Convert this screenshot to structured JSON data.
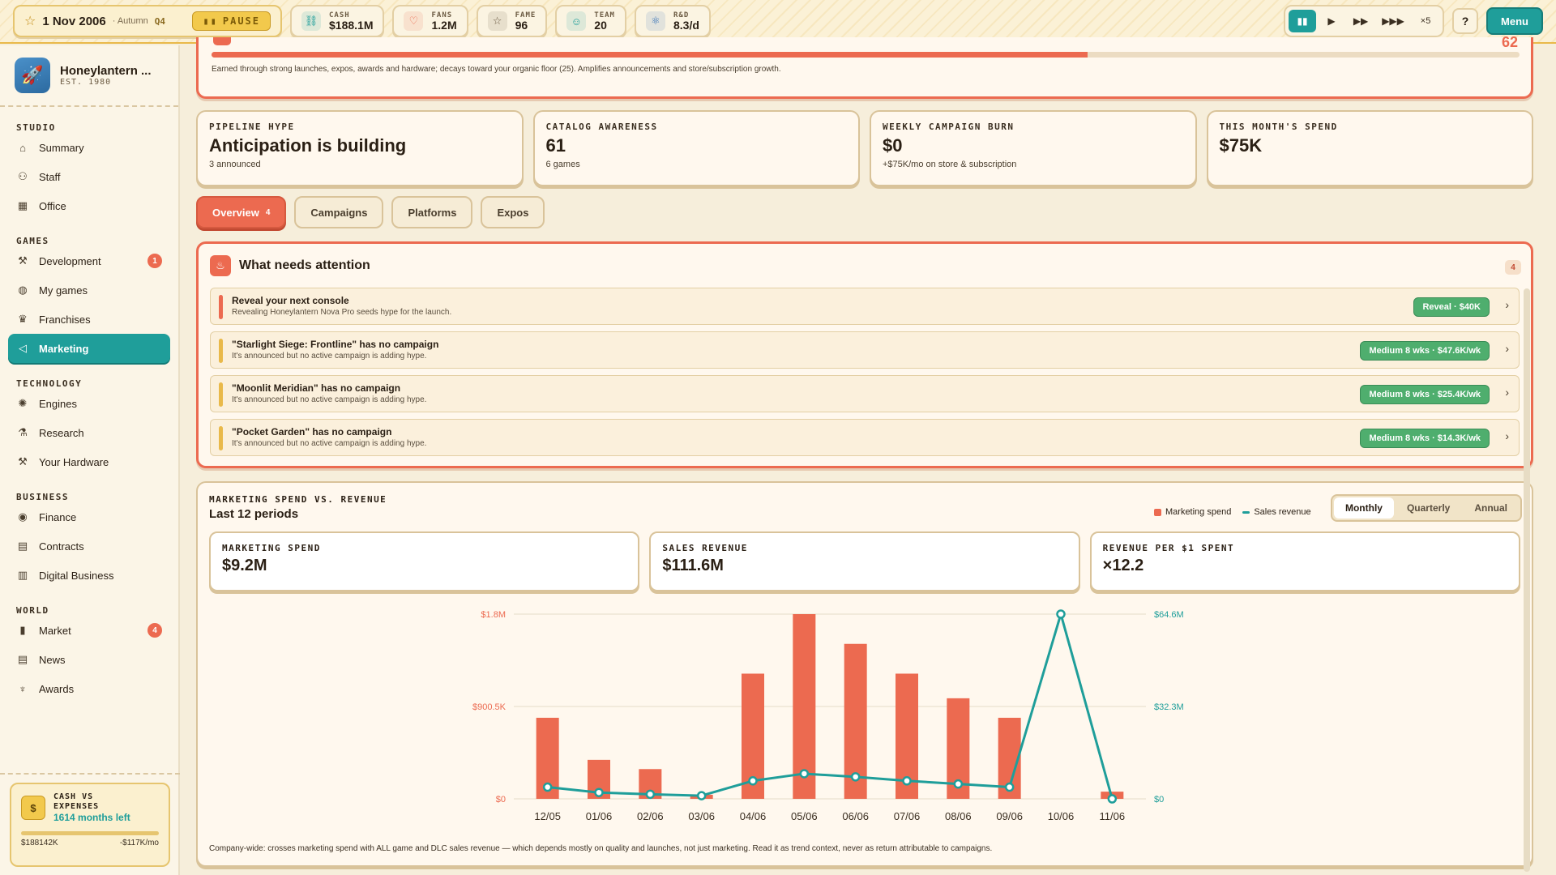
{
  "topbar": {
    "date": "1 Nov 2006",
    "season": "· Autumn",
    "quarter": "Q4",
    "pause_label": "PAUSE",
    "stats": [
      {
        "label": "CASH",
        "value": "$188.1M",
        "icon": "link-icon",
        "color": "#1f9e9a"
      },
      {
        "label": "FANS",
        "value": "1.2M",
        "icon": "heart-icon",
        "color": "#ec6a50"
      },
      {
        "label": "FAME",
        "value": "96",
        "icon": "star-icon",
        "color": "#6b5a42"
      },
      {
        "label": "TEAM",
        "value": "20",
        "icon": "team-icon",
        "color": "#1f9e9a"
      },
      {
        "label": "R&D",
        "value": "8.3/d",
        "icon": "atom-icon",
        "color": "#3a74b8"
      }
    ],
    "speed_multiplier": "×5",
    "help_label": "?",
    "menu_label": "Menu"
  },
  "sidebar": {
    "studio_name": "Honeylantern ...",
    "studio_est": "EST. 1980",
    "sections": [
      {
        "title": "STUDIO",
        "items": [
          {
            "label": "Summary",
            "icon": "home-icon",
            "glyph": "⌂"
          },
          {
            "label": "Staff",
            "icon": "staff-icon",
            "glyph": "⚇"
          },
          {
            "label": "Office",
            "icon": "office-icon",
            "glyph": "▦"
          }
        ]
      },
      {
        "title": "GAMES",
        "items": [
          {
            "label": "Development",
            "icon": "hammer-icon",
            "glyph": "⚒",
            "badge": "1"
          },
          {
            "label": "My games",
            "icon": "gamepad-icon",
            "glyph": "◍"
          },
          {
            "label": "Franchises",
            "icon": "crown-icon",
            "glyph": "♛"
          },
          {
            "label": "Marketing",
            "icon": "megaphone-icon",
            "glyph": "◁",
            "active": true
          }
        ]
      },
      {
        "title": "TECHNOLOGY",
        "items": [
          {
            "label": "Engines",
            "icon": "gear-icon",
            "glyph": "✺"
          },
          {
            "label": "Research",
            "icon": "flask-icon",
            "glyph": "⚗"
          },
          {
            "label": "Your Hardware",
            "icon": "hardware-icon",
            "glyph": "⚒"
          }
        ]
      },
      {
        "title": "BUSINESS",
        "items": [
          {
            "label": "Finance",
            "icon": "coin-icon",
            "glyph": "◉"
          },
          {
            "label": "Contracts",
            "icon": "contract-icon",
            "glyph": "▤"
          },
          {
            "label": "Digital Business",
            "icon": "store-icon",
            "glyph": "▥"
          }
        ]
      },
      {
        "title": "WORLD",
        "items": [
          {
            "label": "Market",
            "icon": "bar-chart-icon",
            "glyph": "▮",
            "badge": "4"
          },
          {
            "label": "News",
            "icon": "newspaper-icon",
            "glyph": "▤"
          },
          {
            "label": "Awards",
            "icon": "trophy-icon",
            "glyph": "♆"
          }
        ]
      }
    ],
    "cash_card": {
      "label": "CASH VS EXPENSES",
      "months_left": "1614 months left",
      "cash": "$188142K",
      "burn": "-$117K/mo",
      "coin": "$"
    }
  },
  "hype": {
    "progress": 0.67,
    "value": "62",
    "description": "Earned through strong launches, expos, awards and hardware; decays toward your organic floor (25). Amplifies announcements and store/subscription growth."
  },
  "cards": [
    {
      "label": "PIPELINE HYPE",
      "value": "Anticipation is building",
      "sub": "3 announced"
    },
    {
      "label": "CATALOG AWARENESS",
      "value": "61",
      "sub": "6 games"
    },
    {
      "label": "WEEKLY CAMPAIGN BURN",
      "value": "$0",
      "sub": "+$75K/mo on store & subscription"
    },
    {
      "label": "THIS MONTH'S SPEND",
      "value": "$75K",
      "sub": ""
    }
  ],
  "tabs": [
    {
      "label": "Overview",
      "count": "4",
      "active": true
    },
    {
      "label": "Campaigns"
    },
    {
      "label": "Platforms"
    },
    {
      "label": "Expos"
    }
  ],
  "attention": {
    "title": "What needs attention",
    "count": "4",
    "items": [
      {
        "title": "Reveal your next console",
        "desc": "Revealing Honeylantern Nova Pro seeds hype for the launch.",
        "action": "Reveal · $40K",
        "stripe": "#ec6a50"
      },
      {
        "title": "\"Starlight Siege: Frontline\" has no campaign",
        "desc": "It's announced but no active campaign is adding hype.",
        "action": "Medium 8 wks · $47.6K/wk",
        "stripe": "#e9b94a"
      },
      {
        "title": "\"Moonlit Meridian\" has no campaign",
        "desc": "It's announced but no active campaign is adding hype.",
        "action": "Medium 8 wks · $25.4K/wk",
        "stripe": "#e9b94a"
      },
      {
        "title": "\"Pocket Garden\" has no campaign",
        "desc": "It's announced but no active campaign is adding hype.",
        "action": "Medium 8 wks · $14.3K/wk",
        "stripe": "#e9b94a"
      }
    ]
  },
  "chart_panel": {
    "label": "MARKETING SPEND VS. REVENUE",
    "subtitle": "Last 12 periods",
    "legend": [
      {
        "label": "Marketing spend",
        "color": "#ec6a50",
        "kind": "bar"
      },
      {
        "label": "Sales revenue",
        "color": "#1f9e9a",
        "kind": "line"
      }
    ],
    "periods": [
      {
        "label": "Monthly",
        "active": true
      },
      {
        "label": "Quarterly"
      },
      {
        "label": "Annual"
      }
    ],
    "kpis": [
      {
        "label": "MARKETING SPEND",
        "value": "$9.2M"
      },
      {
        "label": "SALES REVENUE",
        "value": "$111.6M"
      },
      {
        "label": "REVENUE PER $1 SPENT",
        "value": "×12.2"
      }
    ],
    "footnote": "Company-wide: crosses marketing spend with ALL game and DLC sales revenue — which depends mostly on quality and launches, not just marketing. Read it as trend context, never as return attributable to campaigns."
  },
  "chart_data": {
    "type": "bar",
    "categories": [
      "12/05",
      "01/06",
      "02/06",
      "03/06",
      "04/06",
      "05/06",
      "06/06",
      "07/06",
      "08/06",
      "09/06",
      "10/06",
      "11/06"
    ],
    "series": [
      {
        "name": "Marketing spend",
        "type": "bar",
        "axis": "left",
        "color": "#ec6a50",
        "values": [
          790000,
          380000,
          290000,
          40000,
          1220000,
          1800000,
          1510000,
          1220000,
          980000,
          790000,
          0,
          70000
        ]
      },
      {
        "name": "Sales revenue",
        "type": "line",
        "axis": "right",
        "color": "#1f9e9a",
        "values": [
          4100000,
          2200000,
          1600000,
          1100000,
          6300000,
          8800000,
          7700000,
          6300000,
          5200000,
          4100000,
          64600000,
          0
        ]
      }
    ],
    "y_left": {
      "range": [
        0,
        1800000
      ],
      "ticks": [
        "$0",
        "$900.5K",
        "$1.8M"
      ],
      "color": "#ec6a50"
    },
    "y_right": {
      "range": [
        0,
        64600000
      ],
      "ticks": [
        "$0",
        "$32.3M",
        "$64.6M"
      ],
      "color": "#1f9e9a"
    },
    "grid": true
  }
}
